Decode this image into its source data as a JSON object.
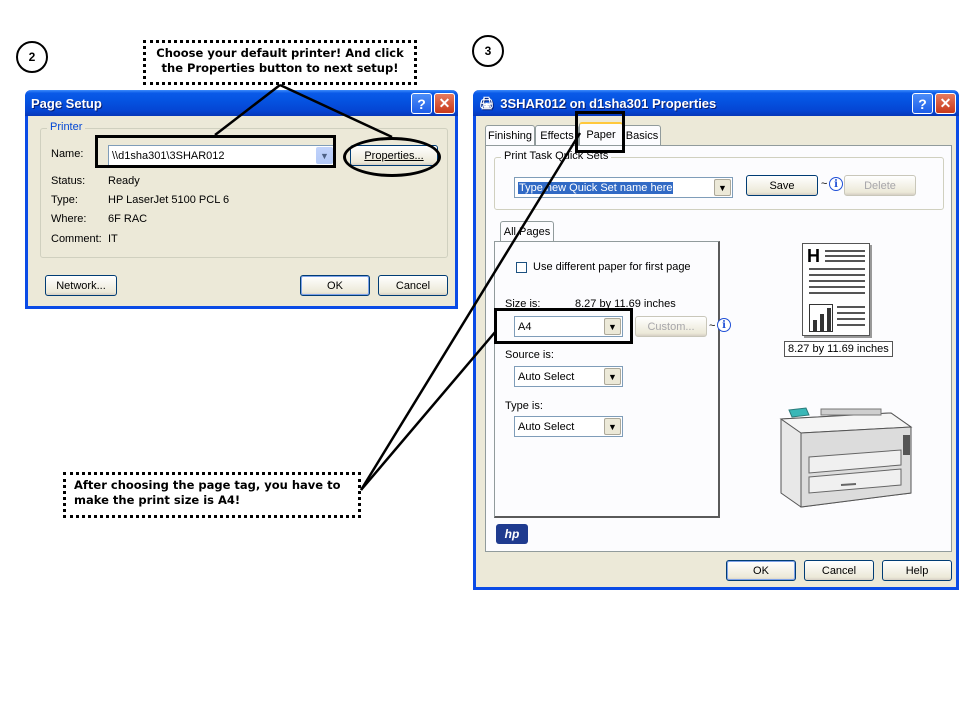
{
  "steps": {
    "two": "2",
    "three": "3"
  },
  "callouts": {
    "top": "Choose your default printer! And click the Properties button to next setup!",
    "bottom": "After choosing the page tag, you have to make the print size is A4!"
  },
  "page_setup": {
    "title": "Page Setup",
    "group_label": "Printer",
    "name_label": "Name:",
    "name_value": "\\\\d1sha301\\3SHAR012",
    "properties_button": "Properties...",
    "status_label": "Status:",
    "status_value": "Ready",
    "type_label": "Type:",
    "type_value": "HP LaserJet 5100 PCL 6",
    "where_label": "Where:",
    "where_value": "6F RAC",
    "comment_label": "Comment:",
    "comment_value": "IT",
    "network_button": "Network...",
    "ok_button": "OK",
    "cancel_button": "Cancel"
  },
  "properties": {
    "title": "3SHAR012 on d1sha301 Properties",
    "tabs": [
      "Finishing",
      "Effects",
      "Paper",
      "Basics"
    ],
    "active_tab": "Paper",
    "quick_sets_label": "Print Task Quick Sets",
    "quick_set_value": "Type new Quick Set name here",
    "save_button": "Save",
    "delete_button": "Delete",
    "all_pages_tab": "All Pages",
    "use_diff_paper_label": "Use different paper for first page",
    "size_label": "Size is:",
    "size_dims": "8.27 by 11.69 inches",
    "size_value": "A4",
    "custom_button": "Custom...",
    "source_label": "Source is:",
    "source_value": "Auto Select",
    "type_label": "Type is:",
    "type_value": "Auto Select",
    "preview_caption": "8.27 by 11.69 inches",
    "ok_button": "OK",
    "cancel_button": "Cancel",
    "help_button": "Help",
    "hp_logo": "hp"
  },
  "colors": {
    "titlebar": "#0553e1",
    "dialog_bg": "#ece9d8",
    "tab_highlight": "#ffc83c"
  }
}
